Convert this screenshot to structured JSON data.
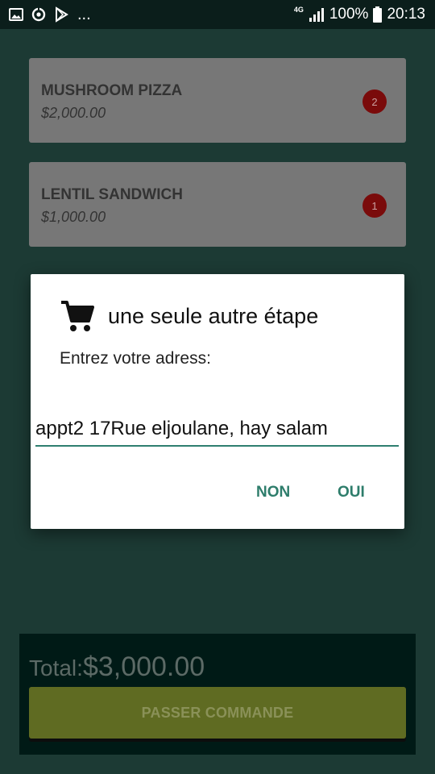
{
  "status_bar": {
    "network": "4G",
    "battery": "100%",
    "time": "20:13",
    "notifications": [
      "image-icon",
      "sync-icon",
      "play-store-icon"
    ],
    "more": "..."
  },
  "cart": {
    "items": [
      {
        "name": "MUSHROOM PIZZA",
        "price": "$2,000.00",
        "quantity": "2"
      },
      {
        "name": "LENTIL SANDWICH",
        "price": "$1,000.00",
        "quantity": "1"
      }
    ],
    "total_label": "Total:",
    "total_value": "$3,000.00",
    "order_button": "PASSER COMMANDE"
  },
  "dialog": {
    "icon": "shopping-cart-icon",
    "title": "une seule autre étape",
    "message": "Entrez votre adress:",
    "address_value": "appt2 17Rue eljoulane, hay salam",
    "cancel_label": "NON",
    "confirm_label": "OUI"
  },
  "colors": {
    "background": "#1c3a34",
    "status_bar": "#0b1e1b",
    "accent": "#2e7d6b",
    "badge": "#7a0b0b",
    "order_button": "#5f6b22"
  }
}
